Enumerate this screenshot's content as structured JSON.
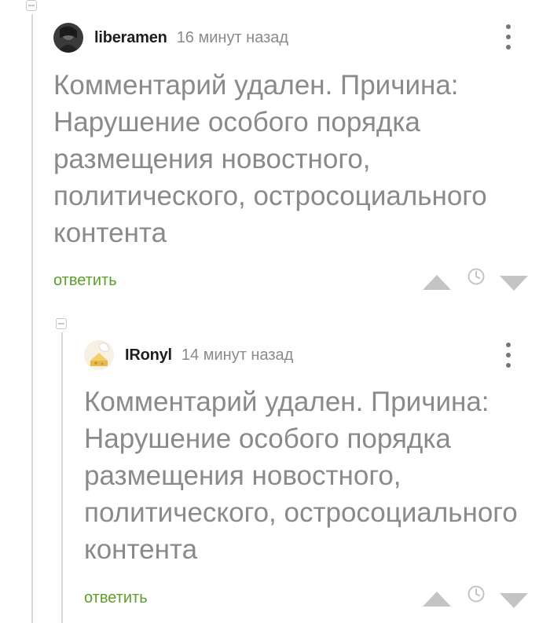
{
  "comments": [
    {
      "author": "liberamen",
      "time": "16 минут назад",
      "text": "Комментарий удален. Причина: Нарушение особого порядка размещения новостного, политического, остросоциального контента",
      "reply_label": "ответить"
    },
    {
      "author": "IRonyl",
      "time": "14 минут назад",
      "text": "Комментарий удален. Причина: Нарушение особого порядка размещения новостного, политического, остросоциального контента",
      "reply_label": "ответить"
    }
  ],
  "icons": {
    "collapse": "collapse-icon",
    "more": "kebab-menu-icon",
    "upvote": "triangle-up-icon",
    "time": "clock-icon",
    "downvote": "triangle-down-icon"
  },
  "colors": {
    "reply_link": "#5d9e2b",
    "deleted_text": "#8a8a8a",
    "vote_icons": "#c4c4c4"
  }
}
